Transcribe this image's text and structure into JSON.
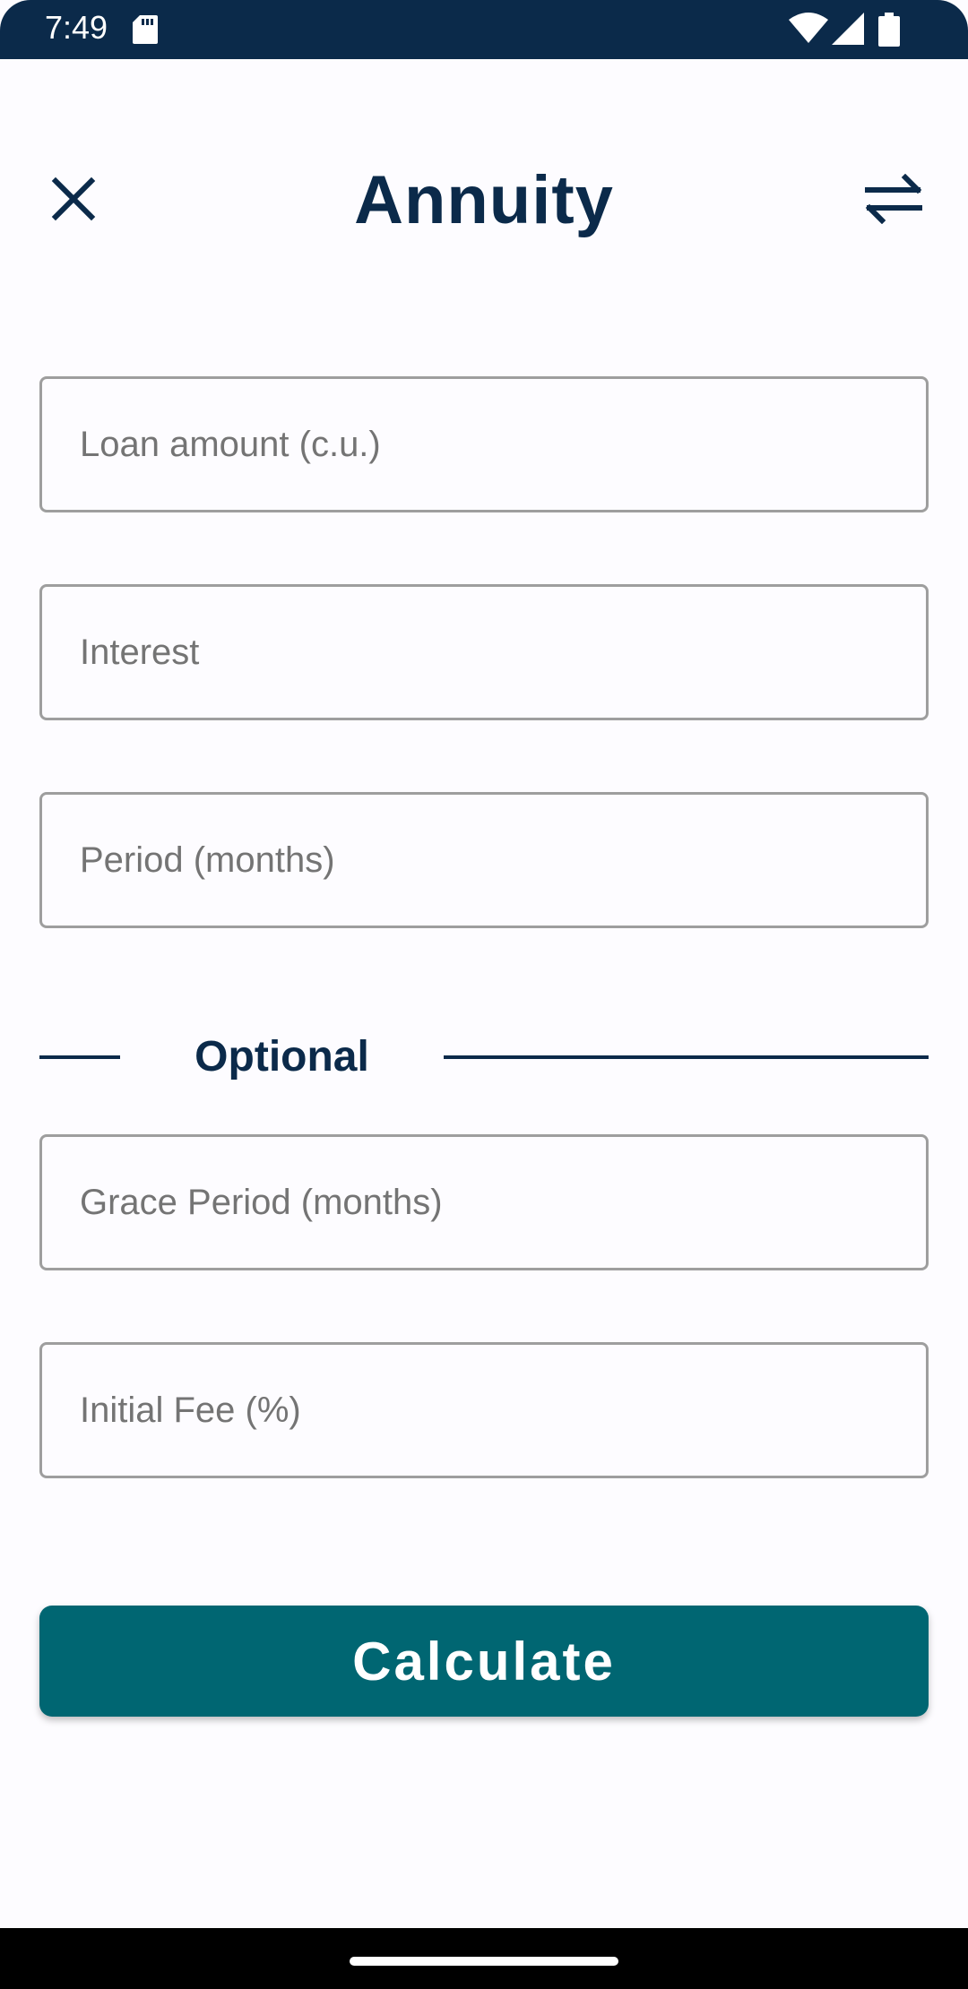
{
  "status_bar": {
    "time": "7:49",
    "icons": [
      "sd-card-icon",
      "wifi-icon",
      "signal-icon",
      "battery-icon"
    ]
  },
  "app_bar": {
    "title": "Annuity",
    "left_icon": "close-icon",
    "right_icon": "swap-icon"
  },
  "form": {
    "loan_amount_placeholder": "Loan amount (c.u.)",
    "interest_placeholder": "Interest",
    "period_placeholder": "Period (months)",
    "optional_label": "Optional",
    "grace_period_placeholder": "Grace Period (months)",
    "initial_fee_placeholder": "Initial Fee (%)"
  },
  "actions": {
    "calculate_label": "Calculate"
  },
  "colors": {
    "primary_dark": "#0b2a4a",
    "button": "#006672",
    "field_border": "#9e9e9e",
    "background": "#fdfcff"
  }
}
